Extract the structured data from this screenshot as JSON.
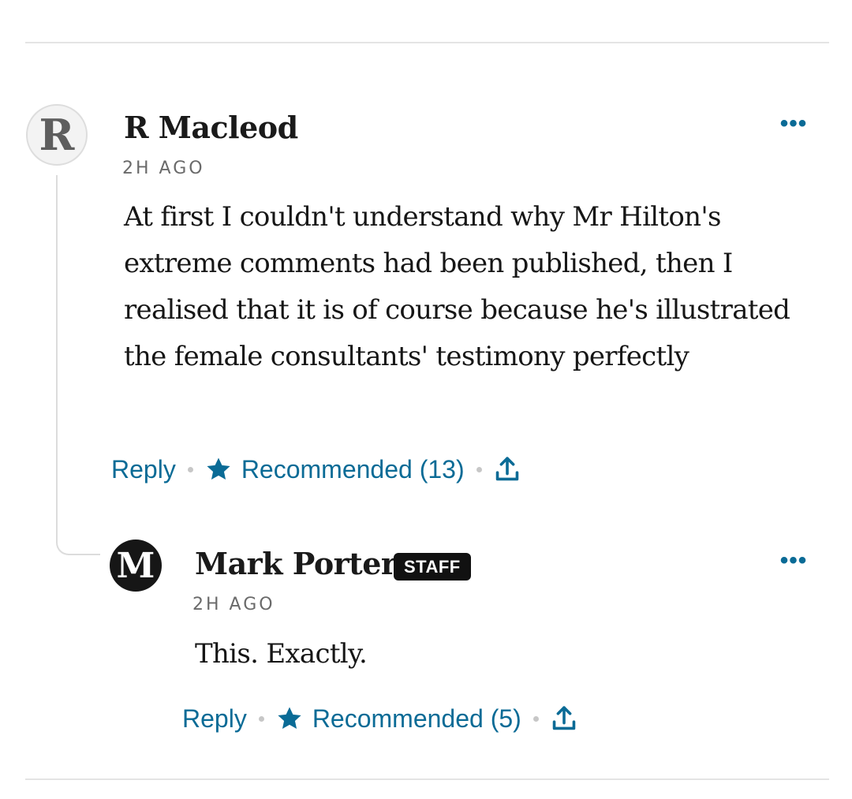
{
  "comments": [
    {
      "avatar_initial": "R",
      "author": "R Macleod",
      "timestamp": "2H AGO",
      "body": "At first I couldn't understand why Mr Hilton's extreme comments had been published, then I realised that it is of course because he's illustrated the female consultants' testimony perfectly",
      "reply_label": "Reply",
      "recommended_label": "Recommended (13)",
      "more_label": "•••"
    },
    {
      "avatar_initial": "M",
      "author": "Mark Porter",
      "badge": "STAFF",
      "timestamp": "2H AGO",
      "body": "This. Exactly.",
      "reply_label": "Reply",
      "recommended_label": "Recommended (5)",
      "more_label": "•••"
    }
  ],
  "colors": {
    "accent": "#0a6b96",
    "text": "#161616",
    "meta": "#6a6a6a",
    "divider": "#e4e4e4"
  },
  "icons": [
    "star-icon",
    "share-icon",
    "more-options-icon"
  ]
}
